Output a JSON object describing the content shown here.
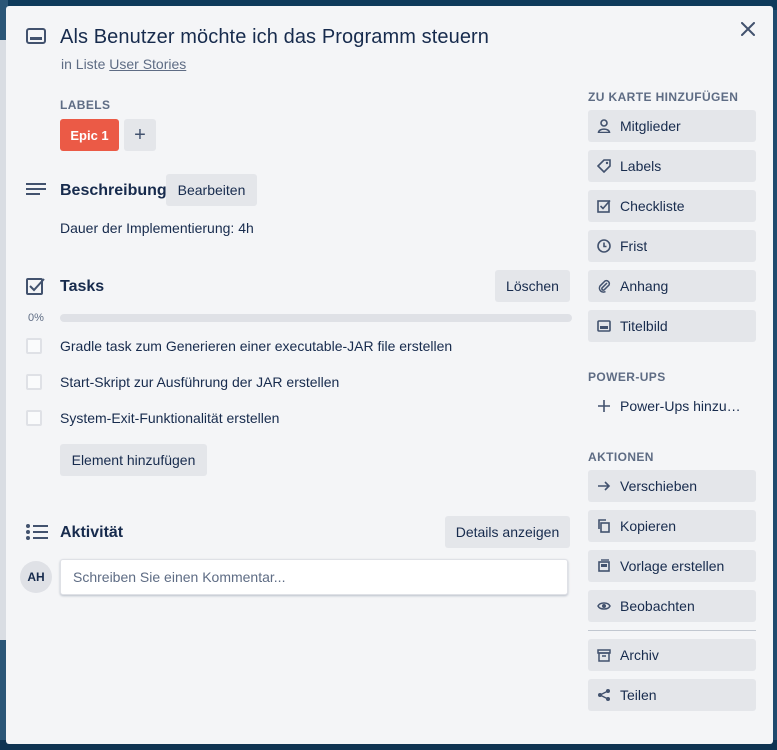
{
  "card": {
    "title": "Als Benutzer möchte ich das Programm steuern",
    "list_prefix": "in Liste",
    "list_name": "User Stories"
  },
  "labels": {
    "heading": "LABELS",
    "items": [
      {
        "text": "Epic 1",
        "color": "#eb5a46"
      }
    ],
    "add_symbol": "+"
  },
  "description": {
    "heading": "Beschreibung",
    "edit_label": "Bearbeiten",
    "text": "Dauer der Implementierung: 4h"
  },
  "checklist": {
    "heading": "Tasks",
    "delete_label": "Löschen",
    "progress_text": "0%",
    "progress_value": 0,
    "items": [
      {
        "text": "Gradle task zum Generieren einer executable-JAR file erstellen",
        "checked": false
      },
      {
        "text": "Start-Skript zur Ausführung der JAR erstellen",
        "checked": false
      },
      {
        "text": "System-Exit-Funktionalität erstellen",
        "checked": false
      }
    ],
    "add_item_label": "Element hinzufügen"
  },
  "activity": {
    "heading": "Aktivität",
    "details_label": "Details anzeigen",
    "avatar_initials": "AH",
    "comment_placeholder": "Schreiben Sie einen Kommentar..."
  },
  "sidebar": {
    "add_to_card_heading": "ZU KARTE HINZUFÜGEN",
    "add_to_card": [
      {
        "label": "Mitglieder",
        "icon": "person-icon"
      },
      {
        "label": "Labels",
        "icon": "tag-icon"
      },
      {
        "label": "Checkliste",
        "icon": "checkbox-icon"
      },
      {
        "label": "Frist",
        "icon": "clock-icon"
      },
      {
        "label": "Anhang",
        "icon": "paperclip-icon"
      },
      {
        "label": "Titelbild",
        "icon": "cover-icon"
      }
    ],
    "powerups_heading": "POWER-UPS",
    "powerups_add_label": "Power-Ups hinzufügen",
    "actions_heading": "AKTIONEN",
    "actions": [
      {
        "label": "Verschieben",
        "icon": "arrow-right-icon"
      },
      {
        "label": "Kopieren",
        "icon": "copy-icon"
      },
      {
        "label": "Vorlage erstellen",
        "icon": "template-icon"
      },
      {
        "label": "Beobachten",
        "icon": "eye-icon"
      }
    ],
    "more_actions": [
      {
        "label": "Archiv",
        "icon": "archive-icon"
      },
      {
        "label": "Teilen",
        "icon": "share-icon"
      }
    ]
  },
  "colors": {
    "accent_label": "#eb5a46",
    "modal_bg": "#f4f5f7",
    "button_bg": "#e4e6ea",
    "text": "#172b4d",
    "muted": "#5e6c84"
  }
}
